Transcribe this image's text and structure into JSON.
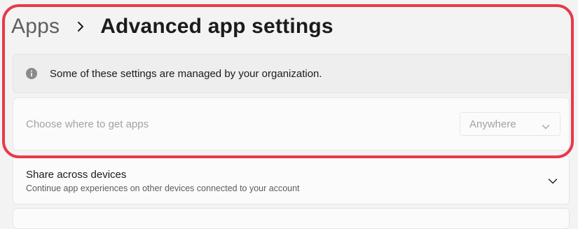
{
  "breadcrumb": {
    "parent": "Apps",
    "separator_icon": "chevron-right-icon",
    "current": "Advanced app settings"
  },
  "info_bar": {
    "icon": "info-icon",
    "text": "Some of these settings are managed by your organization."
  },
  "app_source_setting": {
    "label": "Choose where to get apps",
    "dropdown_value": "Anywhere",
    "dropdown_icon": "chevron-down-icon",
    "disabled": true
  },
  "share_across_devices": {
    "title": "Share across devices",
    "description": "Continue app experiences on other devices connected to your account",
    "expand_icon": "chevron-down-icon"
  },
  "colors": {
    "highlight": "#e8394a",
    "background": "#f3f3f3",
    "card": "#fbfbfb",
    "disabled_text": "#a2a2a2"
  }
}
